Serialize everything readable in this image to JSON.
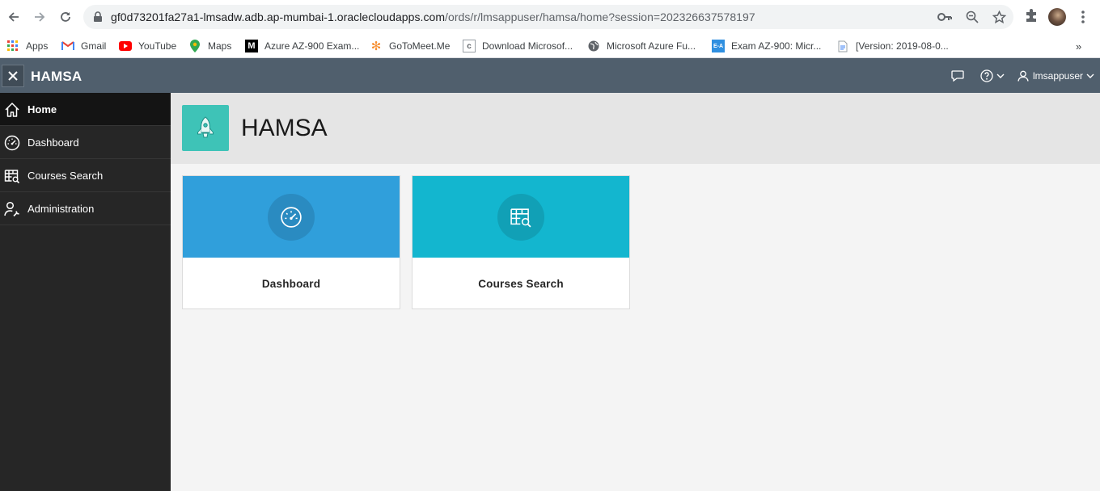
{
  "browser": {
    "url_host": "gf0d73201fa27a1-lmsadw.adb.ap-mumbai-1.oraclecloudapps.com",
    "url_path": "/ords/r/lmsappuser/hamsa/home?session=202326637578197",
    "bookmarks": [
      {
        "label": "Apps",
        "icon": "apps-grid-icon"
      },
      {
        "label": "Gmail",
        "icon": "gmail-icon"
      },
      {
        "label": "YouTube",
        "icon": "youtube-icon"
      },
      {
        "label": "Maps",
        "icon": "maps-icon"
      },
      {
        "label": "Azure AZ-900 Exam...",
        "icon": "medium-icon"
      },
      {
        "label": "GoToMeet.Me",
        "icon": "gotomeet-icon"
      },
      {
        "label": "Download Microsof...",
        "icon": "c-icon"
      },
      {
        "label": "Microsoft Azure Fu...",
        "icon": "globe-icon"
      },
      {
        "label": "Exam AZ-900: Micr...",
        "icon": "exam-icon"
      },
      {
        "label": "[Version: 2019-08-0...",
        "icon": "document-icon"
      }
    ],
    "more_label": "»"
  },
  "app": {
    "title": "HAMSA",
    "user": "lmsappuser"
  },
  "sidebar": {
    "items": [
      {
        "label": "Home",
        "icon": "home-icon",
        "active": true
      },
      {
        "label": "Dashboard",
        "icon": "dashboard-icon",
        "active": false
      },
      {
        "label": "Courses Search",
        "icon": "table-search-icon",
        "active": false
      },
      {
        "label": "Administration",
        "icon": "user-wrench-icon",
        "active": false
      }
    ]
  },
  "hero": {
    "title": "HAMSA",
    "icon": "rocket-icon"
  },
  "cards": [
    {
      "label": "Dashboard",
      "icon": "dashboard-icon",
      "color": "#309fdb"
    },
    {
      "label": "Courses Search",
      "icon": "table-search-icon",
      "color": "#13b6cf"
    }
  ],
  "colors": {
    "header": "#505f6d",
    "sidebar": "#262626",
    "hero_icon": "#3ec3b7"
  }
}
